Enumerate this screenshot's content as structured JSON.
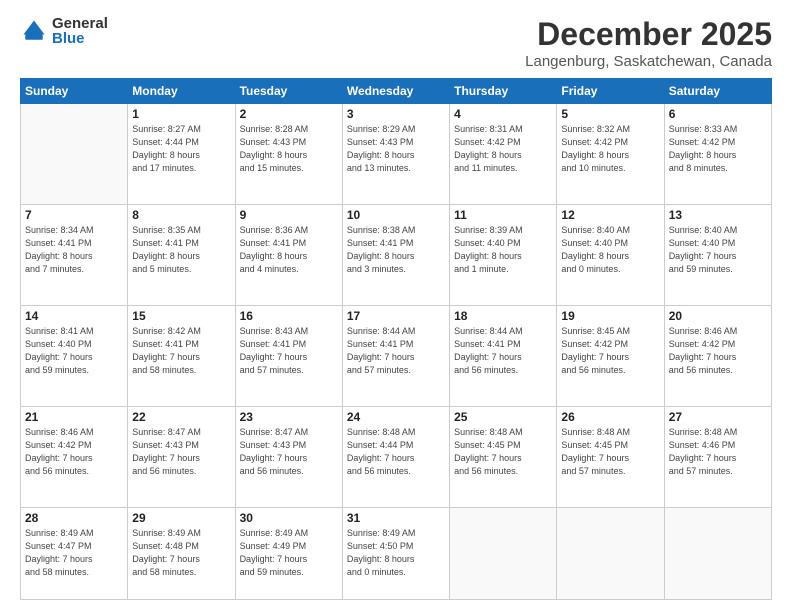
{
  "logo": {
    "general": "General",
    "blue": "Blue"
  },
  "header": {
    "month": "December 2025",
    "location": "Langenburg, Saskatchewan, Canada"
  },
  "weekdays": [
    "Sunday",
    "Monday",
    "Tuesday",
    "Wednesday",
    "Thursday",
    "Friday",
    "Saturday"
  ],
  "weeks": [
    [
      {
        "day": "",
        "info": ""
      },
      {
        "day": "1",
        "info": "Sunrise: 8:27 AM\nSunset: 4:44 PM\nDaylight: 8 hours\nand 17 minutes."
      },
      {
        "day": "2",
        "info": "Sunrise: 8:28 AM\nSunset: 4:43 PM\nDaylight: 8 hours\nand 15 minutes."
      },
      {
        "day": "3",
        "info": "Sunrise: 8:29 AM\nSunset: 4:43 PM\nDaylight: 8 hours\nand 13 minutes."
      },
      {
        "day": "4",
        "info": "Sunrise: 8:31 AM\nSunset: 4:42 PM\nDaylight: 8 hours\nand 11 minutes."
      },
      {
        "day": "5",
        "info": "Sunrise: 8:32 AM\nSunset: 4:42 PM\nDaylight: 8 hours\nand 10 minutes."
      },
      {
        "day": "6",
        "info": "Sunrise: 8:33 AM\nSunset: 4:42 PM\nDaylight: 8 hours\nand 8 minutes."
      }
    ],
    [
      {
        "day": "7",
        "info": "Sunrise: 8:34 AM\nSunset: 4:41 PM\nDaylight: 8 hours\nand 7 minutes."
      },
      {
        "day": "8",
        "info": "Sunrise: 8:35 AM\nSunset: 4:41 PM\nDaylight: 8 hours\nand 5 minutes."
      },
      {
        "day": "9",
        "info": "Sunrise: 8:36 AM\nSunset: 4:41 PM\nDaylight: 8 hours\nand 4 minutes."
      },
      {
        "day": "10",
        "info": "Sunrise: 8:38 AM\nSunset: 4:41 PM\nDaylight: 8 hours\nand 3 minutes."
      },
      {
        "day": "11",
        "info": "Sunrise: 8:39 AM\nSunset: 4:40 PM\nDaylight: 8 hours\nand 1 minute."
      },
      {
        "day": "12",
        "info": "Sunrise: 8:40 AM\nSunset: 4:40 PM\nDaylight: 8 hours\nand 0 minutes."
      },
      {
        "day": "13",
        "info": "Sunrise: 8:40 AM\nSunset: 4:40 PM\nDaylight: 7 hours\nand 59 minutes."
      }
    ],
    [
      {
        "day": "14",
        "info": "Sunrise: 8:41 AM\nSunset: 4:40 PM\nDaylight: 7 hours\nand 59 minutes."
      },
      {
        "day": "15",
        "info": "Sunrise: 8:42 AM\nSunset: 4:41 PM\nDaylight: 7 hours\nand 58 minutes."
      },
      {
        "day": "16",
        "info": "Sunrise: 8:43 AM\nSunset: 4:41 PM\nDaylight: 7 hours\nand 57 minutes."
      },
      {
        "day": "17",
        "info": "Sunrise: 8:44 AM\nSunset: 4:41 PM\nDaylight: 7 hours\nand 57 minutes."
      },
      {
        "day": "18",
        "info": "Sunrise: 8:44 AM\nSunset: 4:41 PM\nDaylight: 7 hours\nand 56 minutes."
      },
      {
        "day": "19",
        "info": "Sunrise: 8:45 AM\nSunset: 4:42 PM\nDaylight: 7 hours\nand 56 minutes."
      },
      {
        "day": "20",
        "info": "Sunrise: 8:46 AM\nSunset: 4:42 PM\nDaylight: 7 hours\nand 56 minutes."
      }
    ],
    [
      {
        "day": "21",
        "info": "Sunrise: 8:46 AM\nSunset: 4:42 PM\nDaylight: 7 hours\nand 56 minutes."
      },
      {
        "day": "22",
        "info": "Sunrise: 8:47 AM\nSunset: 4:43 PM\nDaylight: 7 hours\nand 56 minutes."
      },
      {
        "day": "23",
        "info": "Sunrise: 8:47 AM\nSunset: 4:43 PM\nDaylight: 7 hours\nand 56 minutes."
      },
      {
        "day": "24",
        "info": "Sunrise: 8:48 AM\nSunset: 4:44 PM\nDaylight: 7 hours\nand 56 minutes."
      },
      {
        "day": "25",
        "info": "Sunrise: 8:48 AM\nSunset: 4:45 PM\nDaylight: 7 hours\nand 56 minutes."
      },
      {
        "day": "26",
        "info": "Sunrise: 8:48 AM\nSunset: 4:45 PM\nDaylight: 7 hours\nand 57 minutes."
      },
      {
        "day": "27",
        "info": "Sunrise: 8:48 AM\nSunset: 4:46 PM\nDaylight: 7 hours\nand 57 minutes."
      }
    ],
    [
      {
        "day": "28",
        "info": "Sunrise: 8:49 AM\nSunset: 4:47 PM\nDaylight: 7 hours\nand 58 minutes."
      },
      {
        "day": "29",
        "info": "Sunrise: 8:49 AM\nSunset: 4:48 PM\nDaylight: 7 hours\nand 58 minutes."
      },
      {
        "day": "30",
        "info": "Sunrise: 8:49 AM\nSunset: 4:49 PM\nDaylight: 7 hours\nand 59 minutes."
      },
      {
        "day": "31",
        "info": "Sunrise: 8:49 AM\nSunset: 4:50 PM\nDaylight: 8 hours\nand 0 minutes."
      },
      {
        "day": "",
        "info": ""
      },
      {
        "day": "",
        "info": ""
      },
      {
        "day": "",
        "info": ""
      }
    ]
  ]
}
